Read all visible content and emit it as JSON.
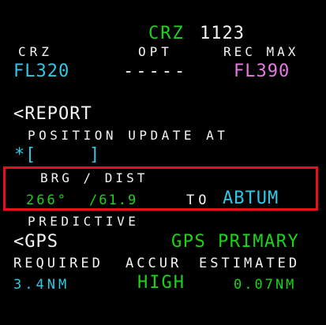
{
  "page": {
    "title_label": "CRZ",
    "title_number": "1123"
  },
  "header": {
    "crz_label": "CRZ",
    "opt_label": "OPT",
    "rec_max_label": "REC MAX",
    "crz_value": "FL320",
    "opt_value": "-----",
    "rec_max_value": "FL390"
  },
  "report": {
    "button_label": "<REPORT"
  },
  "position_update": {
    "label": "POSITION UPDATE AT",
    "field_prefix": "*",
    "field_open": "[",
    "field_close": "]"
  },
  "brg_dist": {
    "label": "BRG / DIST",
    "bearing": "266°",
    "distance": "/61.9",
    "to_label": "TO",
    "waypoint": "ABTUM"
  },
  "predictive": {
    "label": "PREDICTIVE",
    "gps_button": "<GPS",
    "gps_status": "GPS PRIMARY"
  },
  "accuracy": {
    "required_label": "REQUIRED",
    "accur_label": "ACCUR",
    "estimated_label": "ESTIMATED",
    "required_value": "3.4NM",
    "accur_value": "HIGH",
    "estimated_value": "0.07NM"
  },
  "colors": {
    "background": "#000000",
    "label_white": "#f4f4f4",
    "value_green": "#19d419",
    "value_cyan": "#2fc8e6",
    "value_magenta": "#e37ce0",
    "highlight_red": "#e8101a"
  }
}
